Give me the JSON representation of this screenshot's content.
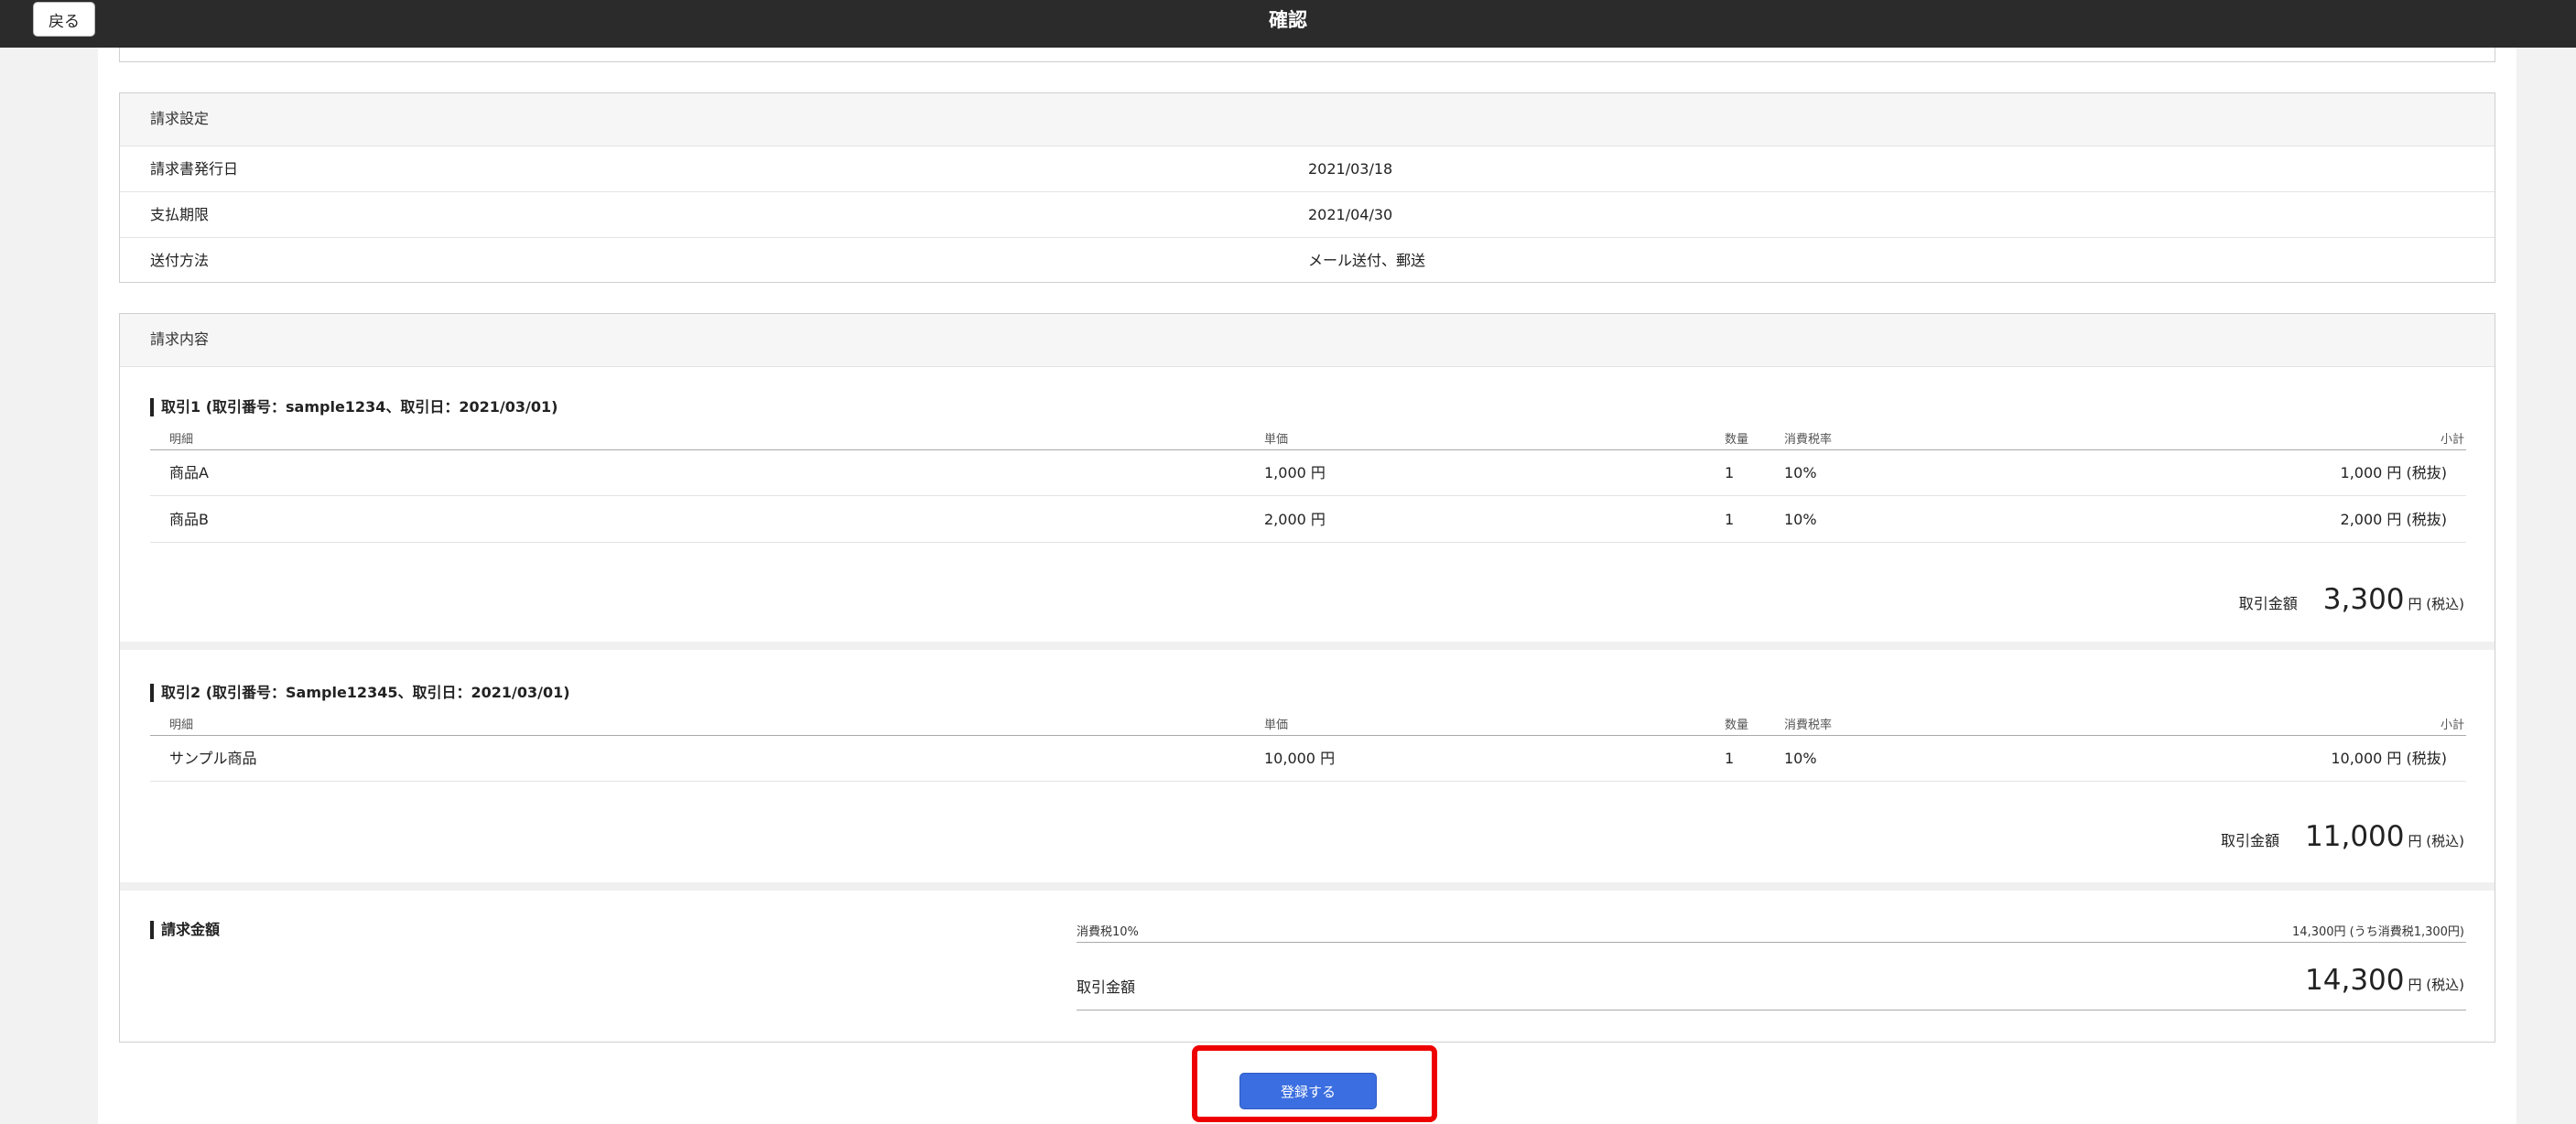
{
  "header": {
    "back_label": "戻る",
    "title": "確認"
  },
  "billing_settings": {
    "title": "請求設定",
    "rows": [
      {
        "label": "請求書発行日",
        "value": "2021/03/18"
      },
      {
        "label": "支払期限",
        "value": "2021/04/30"
      },
      {
        "label": "送付方法",
        "value": "メール送付、郵送"
      }
    ]
  },
  "billing_content": {
    "title": "請求内容",
    "columns": {
      "item": "明細",
      "unit_price": "単価",
      "quantity": "数量",
      "tax_rate": "消費税率",
      "subtotal": "小計"
    },
    "transactions": [
      {
        "title": "取引1 (取引番号：sample1234、取引日：2021/03/01)",
        "rows": [
          {
            "item": "商品A",
            "unit_price": "1,000 円",
            "quantity": "1",
            "tax_rate": "10%",
            "subtotal": "1,000 円 (税抜)"
          },
          {
            "item": "商品B",
            "unit_price": "2,000 円",
            "quantity": "1",
            "tax_rate": "10%",
            "subtotal": "2,000 円 (税抜)"
          }
        ],
        "total_label": "取引金額",
        "total_value": "3,300",
        "total_unit": "円 (税込)"
      },
      {
        "title": "取引2 (取引番号：Sample12345、取引日：2021/03/01)",
        "rows": [
          {
            "item": "サンプル商品",
            "unit_price": "10,000 円",
            "quantity": "1",
            "tax_rate": "10%",
            "subtotal": "10,000 円 (税抜)"
          }
        ],
        "total_label": "取引金額",
        "total_value": "11,000",
        "total_unit": "円 (税込)"
      }
    ],
    "summary": {
      "title": "請求金額",
      "tax_label": "消費税10%",
      "tax_value": "14,300円 (うち消費税1,300円)",
      "total_label": "取引金額",
      "total_value": "14,300",
      "total_unit": "円 (税込)"
    }
  },
  "actions": {
    "register_label": "登録する"
  },
  "colors": {
    "topbar": "#2b2b2b",
    "primary_button": "#3b6ee0",
    "highlight_frame": "#e00000"
  }
}
